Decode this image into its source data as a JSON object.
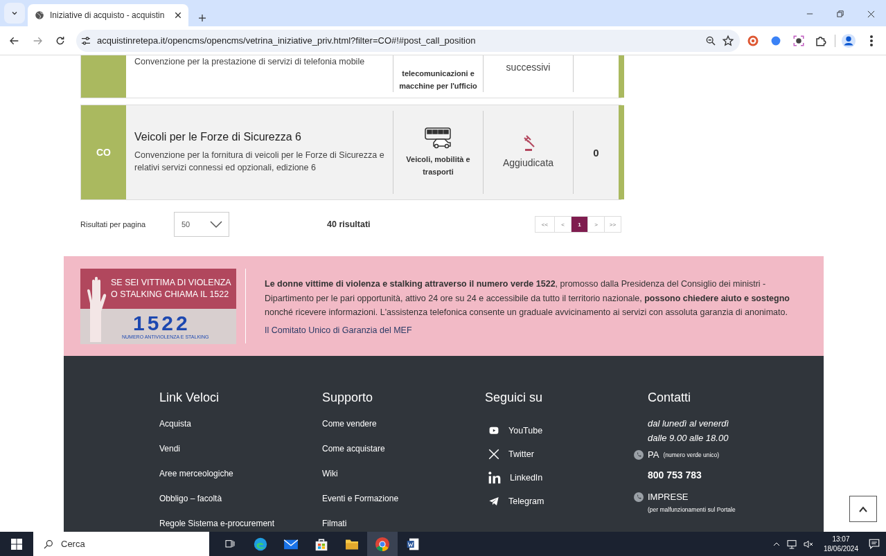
{
  "browser": {
    "tab_title": "Iniziative di acquisto - acquistin",
    "url": "acquistinretepa.it/opencms/opencms/vetrina_iniziative_priv.html?filter=CO#!#post_call_position"
  },
  "initiatives": [
    {
      "kind": "partial",
      "description": "Convenzione per la prestazione di servizi di telefonia mobile",
      "category": "telecomunicazioni e macchine per l'ufficio",
      "status": "successivi"
    },
    {
      "kind": "full",
      "code": "CO",
      "title": "Veicoli per le Forze di Sicurezza 6",
      "description": "Convenzione per la fornitura di veicoli per le Forze di Sicurezza e relativi servizi connessi ed opzionali, edizione 6",
      "category": "Veicoli, mobilità e trasporti",
      "status": "Aggiudicata",
      "count": "0"
    }
  ],
  "results_bar": {
    "per_page_label": "Risultati per pagina",
    "per_page_value": "50",
    "total": "40 risultati",
    "pages": [
      {
        "label": "<<",
        "selected": false
      },
      {
        "label": "<",
        "selected": false
      },
      {
        "label": "1",
        "selected": true
      },
      {
        "label": ">",
        "selected": false
      },
      {
        "label": ">>",
        "selected": false
      }
    ]
  },
  "banner": {
    "image_line_1": "SE SEI VITTIMA DI VIOLENZA",
    "image_line_2": "O STALKING CHIAMA IL 1522",
    "image_number": "1522",
    "image_caption": "NUMERO ANTIVIOLENZA E STALKING",
    "text": "**Le donne vittime di violenza e stalking attraverso il numero verde 1522**, promosso dalla Presidenza del Consiglio dei ministri - Dipartimento per le pari opportunità, attivo 24 ore su 24 e accessibile da tutto il territorio nazionale, **possono chiedere aiuto e sostegno** nonché ricevere informazioni. L'assistenza telefonica consente un graduale avvicinamento ai servizi con assoluta garanzia di anonimato.",
    "signature": "Il Comitato Unico di Garanzia del MEF"
  },
  "footer": {
    "link_veloci": {
      "heading": "Link Veloci",
      "links": [
        "Acquista",
        "Vendi",
        "Aree merceologiche",
        "Obbligo – facoltà",
        "Regole Sistema e-procurement"
      ]
    },
    "supporto": {
      "heading": "Supporto",
      "links": [
        "Come vendere",
        "Come acquistare",
        "Wiki",
        "Eventi e Formazione",
        "Filmati"
      ]
    },
    "social": {
      "heading": "Seguici su",
      "links": [
        {
          "kind": "youtube",
          "label": "YouTube"
        },
        {
          "kind": "x",
          "label": "Twitter"
        },
        {
          "kind": "linkedin",
          "label": "LinkedIn"
        },
        {
          "kind": "telegram",
          "label": "Telegram"
        }
      ]
    },
    "contacts": {
      "heading": "Contatti",
      "hours_1": "dal lunedì al venerdì",
      "hours_2": "dalle 9.00 alle 18.00",
      "pa_label": "PA",
      "pa_note": "(numero verde unico)",
      "pa_number": "800 753 783",
      "imprese_label": "IMPRESE",
      "imprese_note": "(per malfunzionamenti sul Portale"
    }
  },
  "taskbar": {
    "search": "Cerca",
    "time": "13:07",
    "date": "18/06/2024"
  }
}
